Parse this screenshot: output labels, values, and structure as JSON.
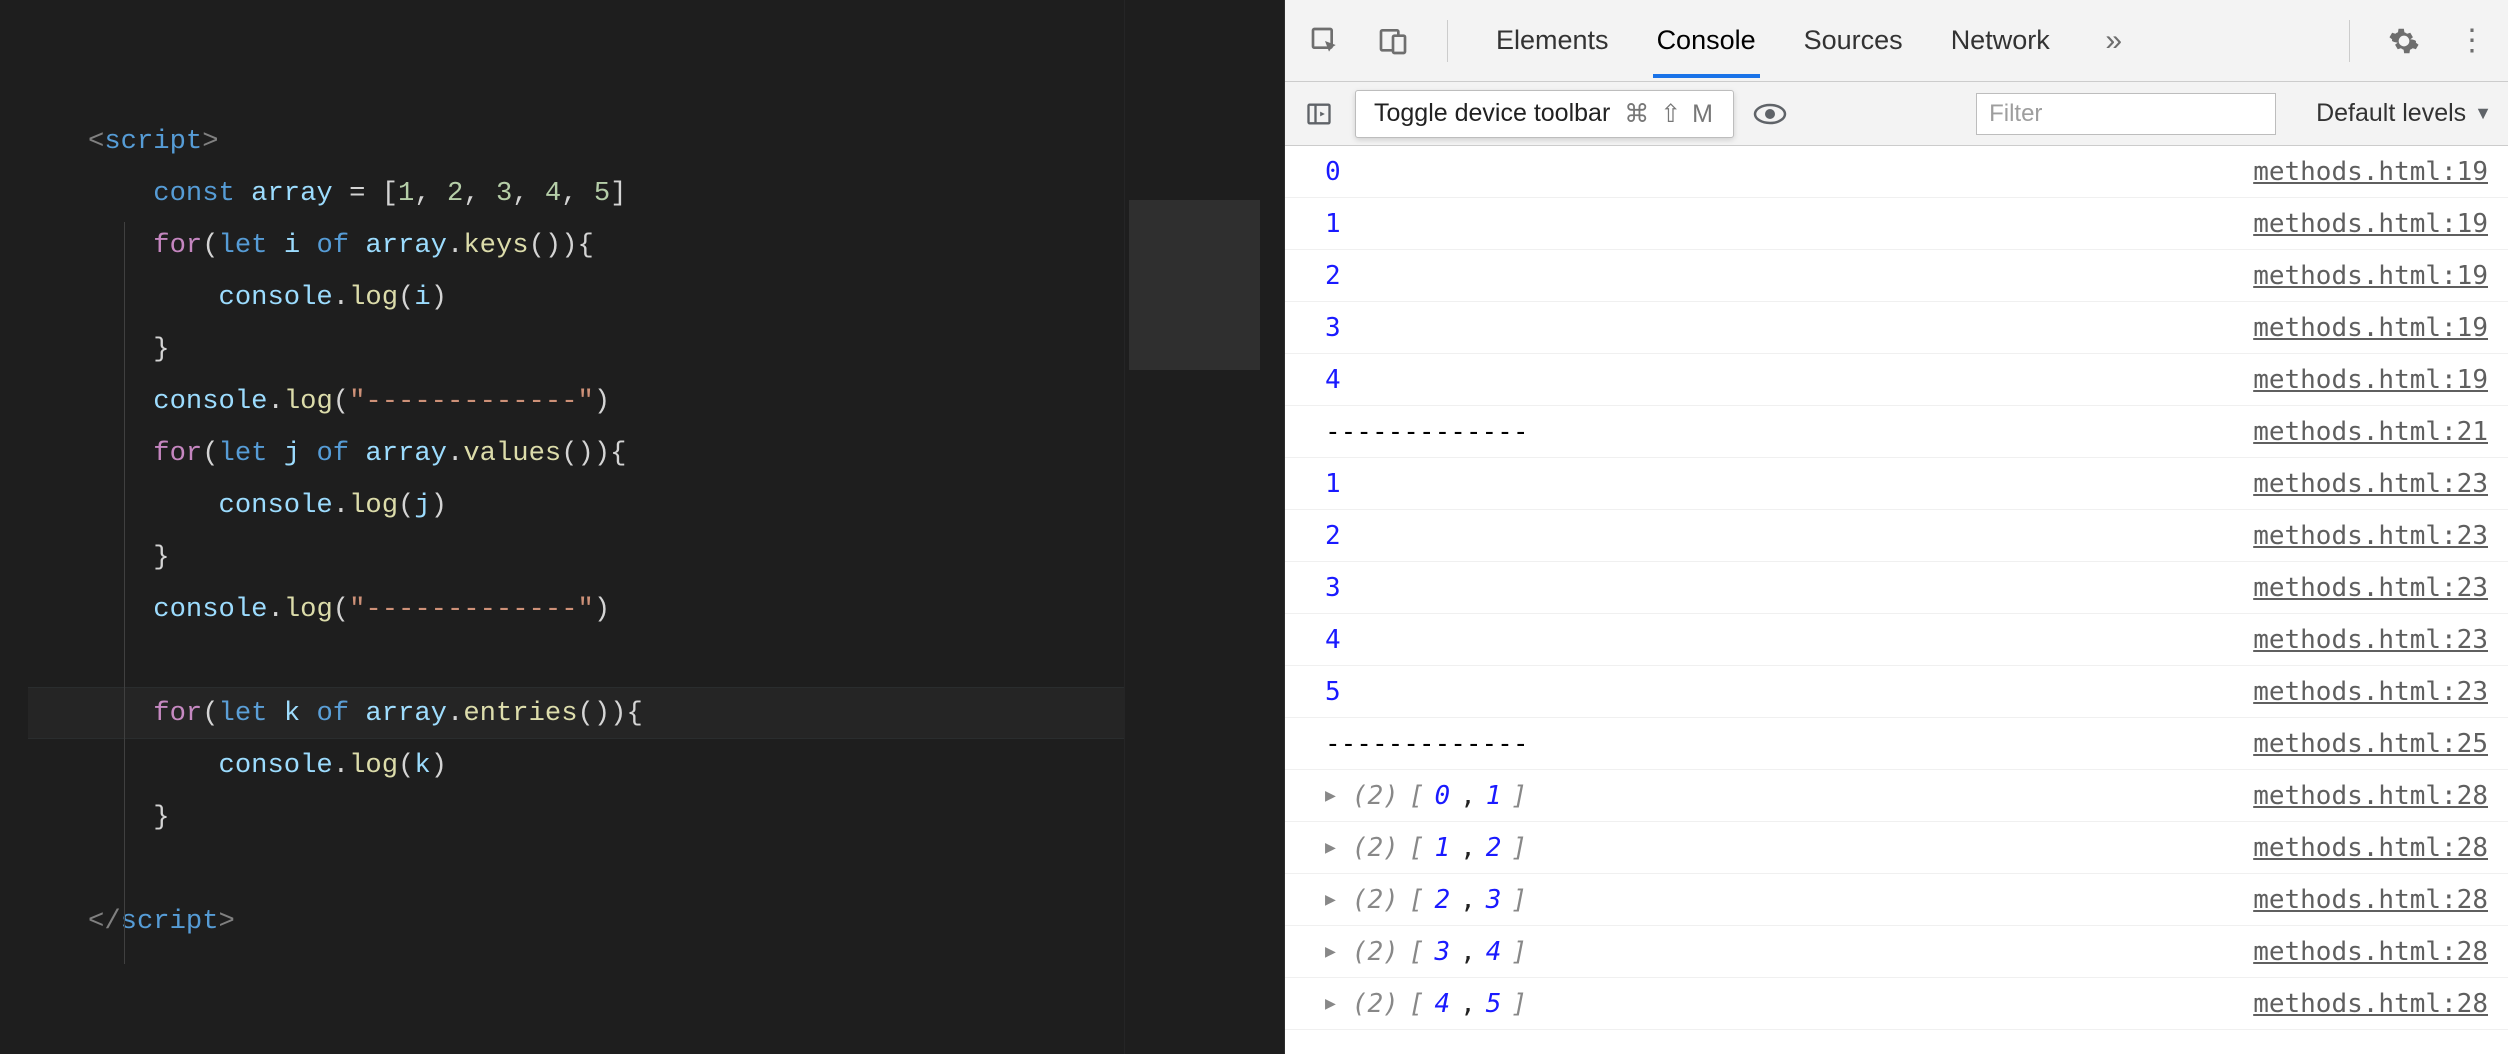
{
  "editor": {
    "code_tokens": [
      [
        [
          "tag",
          "<"
        ],
        [
          "tagn",
          "script"
        ],
        [
          "tag",
          ">"
        ]
      ],
      [
        [
          "pad",
          "    "
        ],
        [
          "kw",
          "const "
        ],
        [
          "var",
          "array"
        ],
        [
          "pun",
          " = ["
        ],
        [
          "num",
          "1"
        ],
        [
          "pun",
          ", "
        ],
        [
          "num",
          "2"
        ],
        [
          "pun",
          ", "
        ],
        [
          "num",
          "3"
        ],
        [
          "pun",
          ", "
        ],
        [
          "num",
          "4"
        ],
        [
          "pun",
          ", "
        ],
        [
          "num",
          "5"
        ],
        [
          "pun",
          "]"
        ]
      ],
      [
        [
          "pad",
          "    "
        ],
        [
          "kw2",
          "for"
        ],
        [
          "pun",
          "("
        ],
        [
          "kw",
          "let "
        ],
        [
          "var",
          "i"
        ],
        [
          "kw",
          " of "
        ],
        [
          "var",
          "array"
        ],
        [
          "pun",
          "."
        ],
        [
          "fn",
          "keys"
        ],
        [
          "pun",
          "()){"
        ]
      ],
      [
        [
          "pad",
          "        "
        ],
        [
          "var",
          "console"
        ],
        [
          "pun",
          "."
        ],
        [
          "fn",
          "log"
        ],
        [
          "pun",
          "("
        ],
        [
          "var",
          "i"
        ],
        [
          "pun",
          ")"
        ]
      ],
      [
        [
          "pad",
          "    "
        ],
        [
          "pun",
          "}"
        ]
      ],
      [
        [
          "pad",
          "    "
        ],
        [
          "var",
          "console"
        ],
        [
          "pun",
          "."
        ],
        [
          "fn",
          "log"
        ],
        [
          "pun",
          "("
        ],
        [
          "str",
          "\"-------------\""
        ],
        [
          "pun",
          ")"
        ]
      ],
      [
        [
          "pad",
          "    "
        ],
        [
          "kw2",
          "for"
        ],
        [
          "pun",
          "("
        ],
        [
          "kw",
          "let "
        ],
        [
          "var",
          "j"
        ],
        [
          "kw",
          " of "
        ],
        [
          "var",
          "array"
        ],
        [
          "pun",
          "."
        ],
        [
          "fn",
          "values"
        ],
        [
          "pun",
          "()){"
        ]
      ],
      [
        [
          "pad",
          "        "
        ],
        [
          "var",
          "console"
        ],
        [
          "pun",
          "."
        ],
        [
          "fn",
          "log"
        ],
        [
          "pun",
          "("
        ],
        [
          "var",
          "j"
        ],
        [
          "pun",
          ")"
        ]
      ],
      [
        [
          "pad",
          "    "
        ],
        [
          "pun",
          "}"
        ]
      ],
      [
        [
          "pad",
          "    "
        ],
        [
          "var",
          "console"
        ],
        [
          "pun",
          "."
        ],
        [
          "fn",
          "log"
        ],
        [
          "pun",
          "("
        ],
        [
          "str",
          "\"-------------\""
        ],
        [
          "pun",
          ")"
        ]
      ],
      [],
      [
        [
          "pad",
          "    "
        ],
        [
          "kw2",
          "for"
        ],
        [
          "pun",
          "("
        ],
        [
          "kw",
          "let "
        ],
        [
          "var",
          "k"
        ],
        [
          "kw",
          " of "
        ],
        [
          "var",
          "array"
        ],
        [
          "pun",
          "."
        ],
        [
          "fn",
          "entries"
        ],
        [
          "pun",
          "()){"
        ]
      ],
      [
        [
          "pad",
          "        "
        ],
        [
          "var",
          "console"
        ],
        [
          "pun",
          "."
        ],
        [
          "fn",
          "log"
        ],
        [
          "pun",
          "("
        ],
        [
          "var",
          "k"
        ],
        [
          "pun",
          ")"
        ]
      ],
      [
        [
          "pad",
          "    "
        ],
        [
          "pun",
          "}"
        ]
      ],
      [],
      [
        [
          "tag",
          "</"
        ],
        [
          "tagn",
          "script"
        ],
        [
          "tag",
          ">"
        ]
      ]
    ]
  },
  "devtools": {
    "tabs": {
      "elements": "Elements",
      "console": "Console",
      "sources": "Sources",
      "network": "Network"
    },
    "tooltip": {
      "text": "Toggle device toolbar",
      "shortcut": "⌘ ⇧ M"
    },
    "filter_placeholder": "Filter",
    "levels_label": "Default levels",
    "console_rows": [
      {
        "type": "num",
        "value": "0",
        "src": "methods.html:19"
      },
      {
        "type": "num",
        "value": "1",
        "src": "methods.html:19"
      },
      {
        "type": "num",
        "value": "2",
        "src": "methods.html:19"
      },
      {
        "type": "num",
        "value": "3",
        "src": "methods.html:19"
      },
      {
        "type": "num",
        "value": "4",
        "src": "methods.html:19"
      },
      {
        "type": "str",
        "value": "-------------",
        "src": "methods.html:21"
      },
      {
        "type": "num",
        "value": "1",
        "src": "methods.html:23"
      },
      {
        "type": "num",
        "value": "2",
        "src": "methods.html:23"
      },
      {
        "type": "num",
        "value": "3",
        "src": "methods.html:23"
      },
      {
        "type": "num",
        "value": "4",
        "src": "methods.html:23"
      },
      {
        "type": "num",
        "value": "5",
        "src": "methods.html:23"
      },
      {
        "type": "str",
        "value": "-------------",
        "src": "methods.html:25"
      },
      {
        "type": "arr",
        "len": "2",
        "items": [
          "0",
          "1"
        ],
        "src": "methods.html:28"
      },
      {
        "type": "arr",
        "len": "2",
        "items": [
          "1",
          "2"
        ],
        "src": "methods.html:28"
      },
      {
        "type": "arr",
        "len": "2",
        "items": [
          "2",
          "3"
        ],
        "src": "methods.html:28"
      },
      {
        "type": "arr",
        "len": "2",
        "items": [
          "3",
          "4"
        ],
        "src": "methods.html:28"
      },
      {
        "type": "arr",
        "len": "2",
        "items": [
          "4",
          "5"
        ],
        "src": "methods.html:28"
      }
    ]
  }
}
